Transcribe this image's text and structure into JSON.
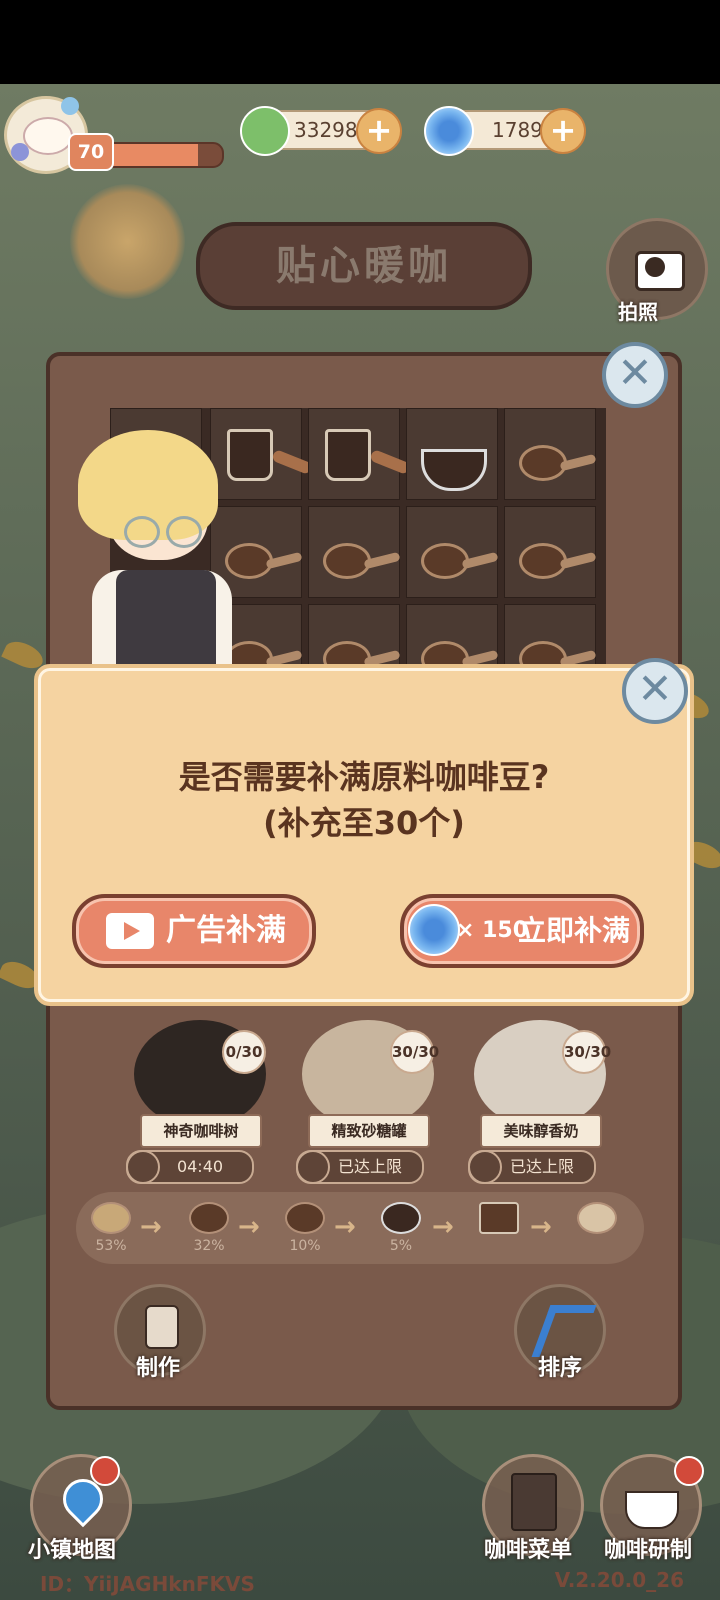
{
  "hud": {
    "level": "70",
    "level_progress": 0.8,
    "currency_green": "33298",
    "currency_blue": "1789",
    "plus": "+"
  },
  "shop_title": "贴心暖咖",
  "camera_label": "拍照",
  "close_glyph": "✕",
  "dialog": {
    "question_line1": "是否需要补满原料咖啡豆?",
    "question_line2": "(补充至30个)",
    "ad_button": "广告补满",
    "buy_multiplier": "× 150",
    "buy_button": "立即补满"
  },
  "materials": [
    {
      "name": "神奇咖啡树",
      "count": "0/30",
      "timer": "04:40"
    },
    {
      "name": "精致砂糖罐",
      "count": "30/30",
      "timer": "已达上限"
    },
    {
      "name": "美味醇香奶",
      "count": "30/30",
      "timer": "已达上限"
    }
  ],
  "process": [
    "53%",
    "32%",
    "10%",
    "5%",
    "",
    ""
  ],
  "process_arrow": "→",
  "make_label": "制作",
  "sort_label": "排序",
  "bottom": {
    "map": "小镇地图",
    "menu": "咖啡菜单",
    "research": "咖啡研制"
  },
  "player_id": "ID：YiiJAGHknFKVS",
  "version": "V.2.20.0_26",
  "colors": {
    "accent": "#e8866a",
    "panel": "#7a5a4b",
    "dialog": "#f5d3a1"
  }
}
